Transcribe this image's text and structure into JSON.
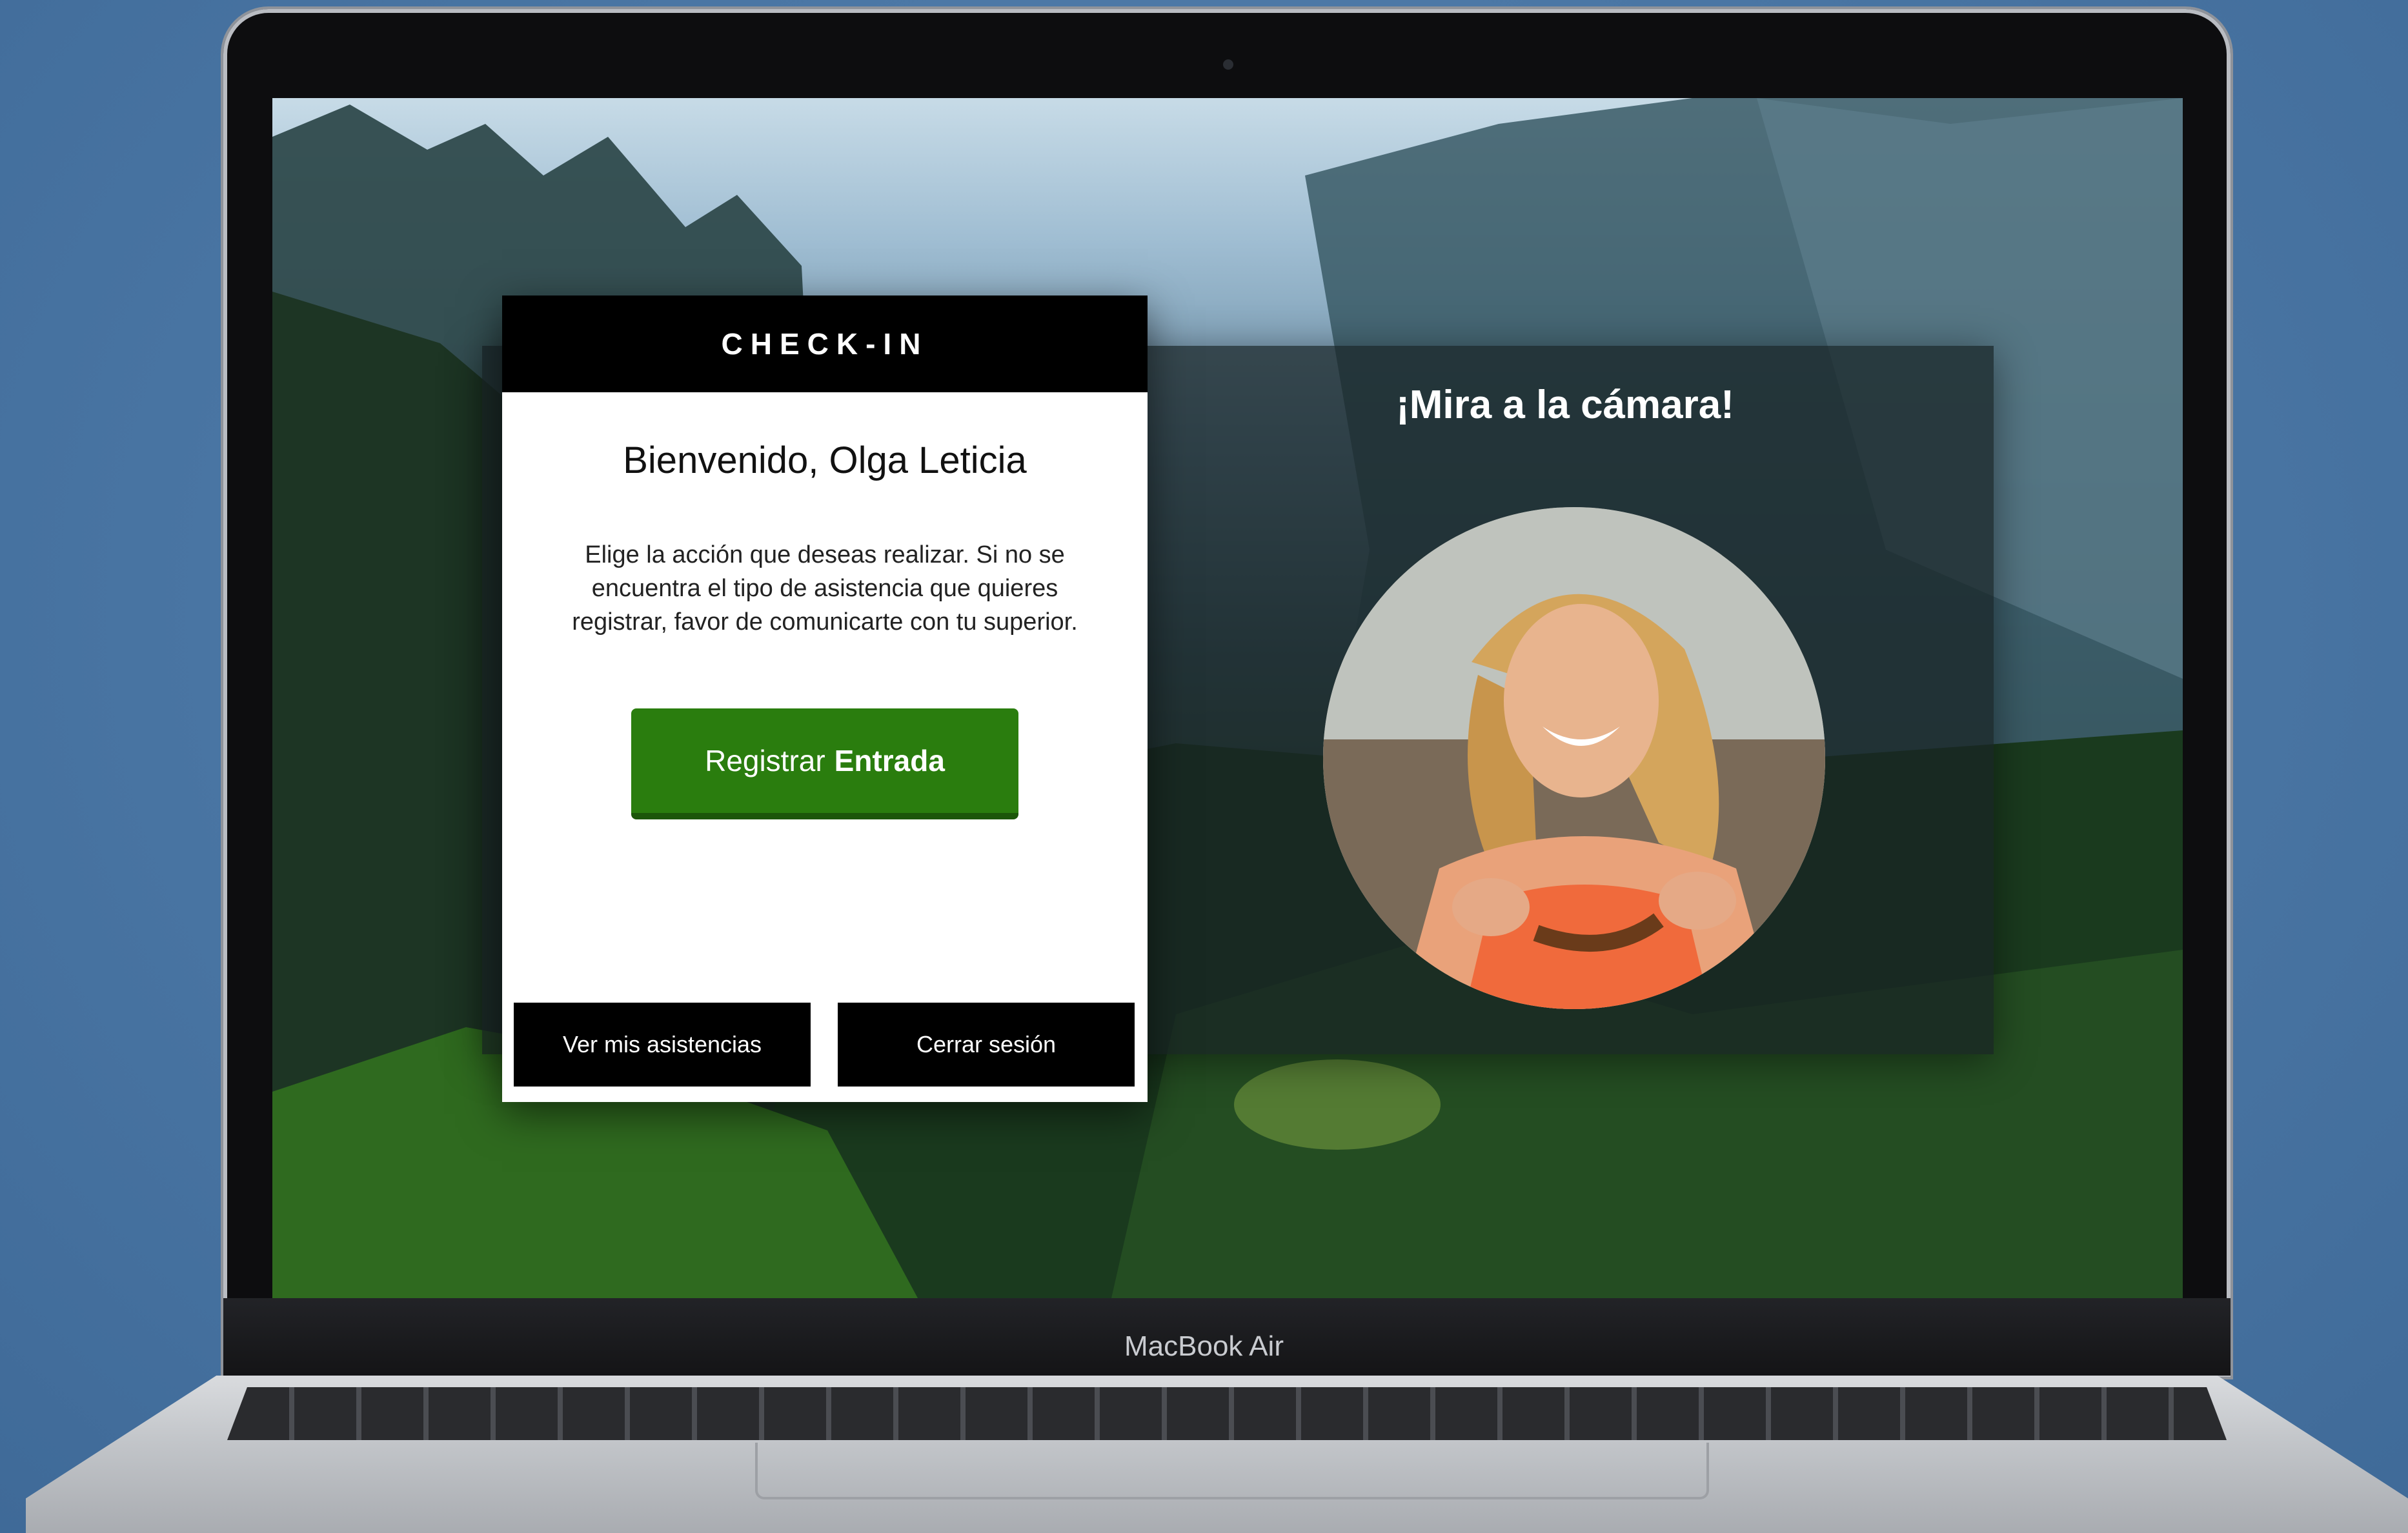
{
  "device": {
    "brand_label": "MacBook Air"
  },
  "checkin_card": {
    "header": "CHECK-IN",
    "welcome": "Bienvenido, Olga Leticia",
    "description": "Elige la acción que deseas realizar. Si no se encuentra el tipo de asistencia que quieres registrar, favor de comunicarte con tu superior.",
    "register_button": {
      "prefix": "Registrar",
      "action": "Entrada"
    },
    "view_attendance_button": "Ver mis asistencias",
    "logout_button": "Cerrar sesión"
  },
  "camera_panel": {
    "title": "¡Mira a la cámara!"
  },
  "colors": {
    "primary_button": "#2a7d0e",
    "header_bg": "#000000",
    "page_bg": "#4a76a4"
  }
}
